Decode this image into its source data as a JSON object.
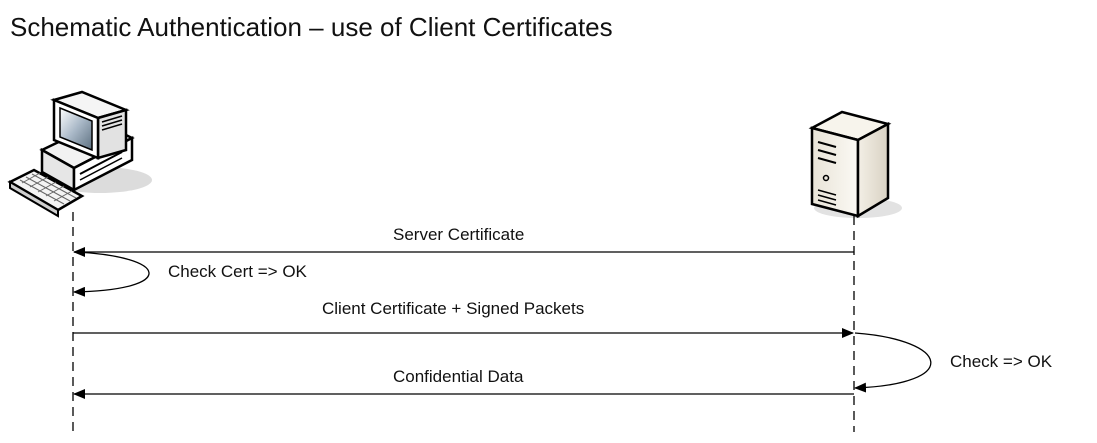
{
  "diagram": {
    "title": "Schematic Authentication – use of Client Certificates",
    "actors": [
      {
        "id": "client",
        "icon": "desktop-computer-icon"
      },
      {
        "id": "server",
        "icon": "tower-server-icon"
      }
    ],
    "messages": [
      {
        "id": "server-certificate",
        "label": "Server Certificate",
        "from": "server",
        "to": "client"
      },
      {
        "id": "check-cert",
        "label": "Check Cert => OK",
        "from": "client",
        "to": "client",
        "self": true
      },
      {
        "id": "client-certificate",
        "label": "Client Certificate + Signed Packets",
        "from": "client",
        "to": "server"
      },
      {
        "id": "check",
        "label": "Check => OK",
        "from": "server",
        "to": "server",
        "self": true
      },
      {
        "id": "confidential-data",
        "label": "Confidential Data",
        "from": "server",
        "to": "client"
      }
    ],
    "colors": {
      "line": "#000000",
      "text": "#111111"
    }
  }
}
